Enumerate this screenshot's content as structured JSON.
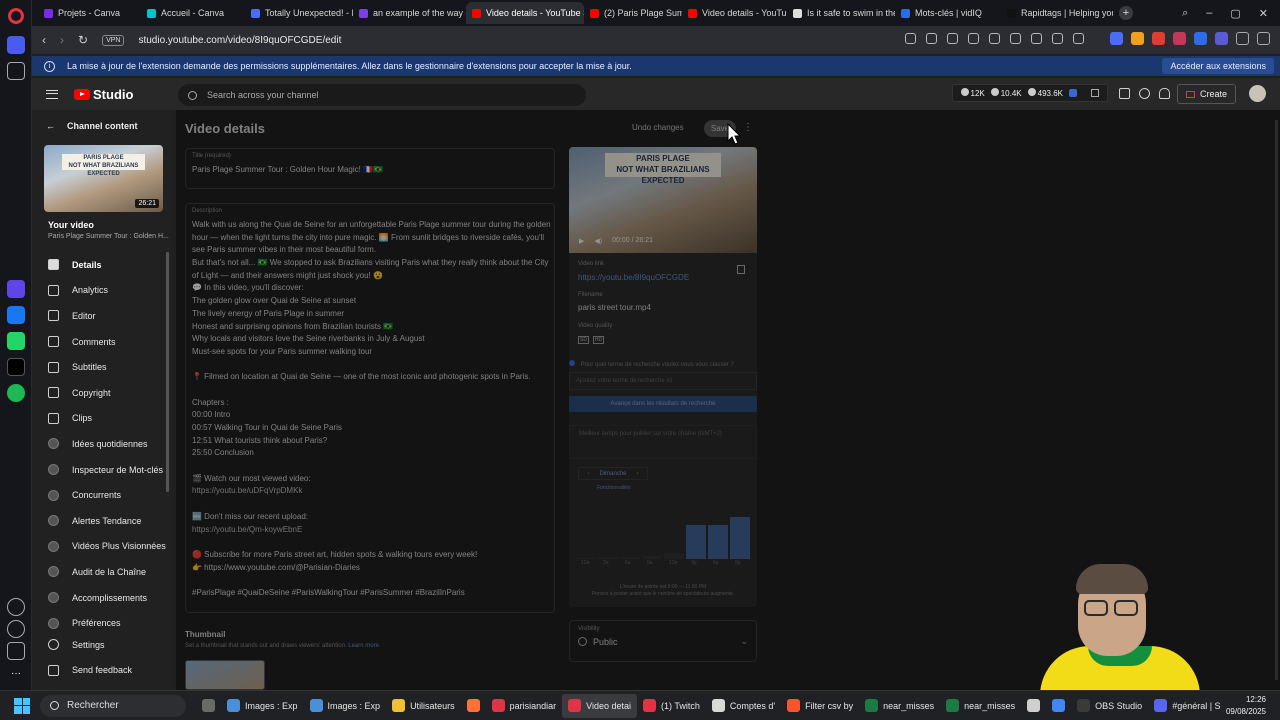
{
  "browser": {
    "tabs": [
      {
        "label": "Projets - Canva",
        "color": "#7d2ae8",
        "active": false
      },
      {
        "label": "Accueil - Canva",
        "color": "#00c4cc",
        "active": false
      },
      {
        "label": "Totally Unexpected! - M",
        "color": "#4a6cf7",
        "active": false
      },
      {
        "label": "an example of the way c",
        "color": "#7b3fe4",
        "active": false
      },
      {
        "label": "Video details - YouTube S",
        "color": "#ff0000",
        "active": true
      },
      {
        "label": "(2) Paris Plage Summer T",
        "color": "#ff0000",
        "active": false
      },
      {
        "label": "Video details - YouTube",
        "color": "#ff0000",
        "active": false
      },
      {
        "label": "Is it safe to swim in the S",
        "color": "#dddddd",
        "active": false
      },
      {
        "label": "Mots-clés | vidIQ",
        "color": "#2e6be6",
        "active": false
      },
      {
        "label": "Rapidtags | Helping you",
        "color": "#111111",
        "active": false
      }
    ],
    "vpn": "VPN",
    "url": "studio.youtube.com/video/8I9quOFCGDE/edit",
    "infobar_text": "La mise à jour de l'extension demande des permissions supplémentaires. Allez dans le gestionnaire d'extensions pour accepter la mise à jour.",
    "infobar_button": "Accéder aux extensions"
  },
  "studio": {
    "logo_text": "Studio",
    "search_placeholder": "Search across your channel",
    "stats": [
      "12K",
      "10.4K",
      "493.6K"
    ],
    "create_label": "Create"
  },
  "sidebar": {
    "channel_content": "Channel content",
    "thumb_banner": "PARIS PLAGE\nNOT WHAT BRAZILIANS EXPECTED",
    "duration": "26:21",
    "your_video": "Your video",
    "video_title": "Paris Plage Summer Tour : Golden H...",
    "items": [
      {
        "label": "Details",
        "active": true,
        "tool": false
      },
      {
        "label": "Analytics",
        "active": false,
        "tool": false
      },
      {
        "label": "Editor",
        "active": false,
        "tool": false
      },
      {
        "label": "Comments",
        "active": false,
        "tool": false
      },
      {
        "label": "Subtitles",
        "active": false,
        "tool": false
      },
      {
        "label": "Copyright",
        "active": false,
        "tool": false
      },
      {
        "label": "Clips",
        "active": false,
        "tool": false
      },
      {
        "label": "Idées quotidiennes",
        "active": false,
        "tool": true
      },
      {
        "label": "Inspecteur de Mot-clés",
        "active": false,
        "tool": true
      },
      {
        "label": "Concurrents",
        "active": false,
        "tool": true
      },
      {
        "label": "Alertes Tendance",
        "active": false,
        "tool": true
      },
      {
        "label": "Vidéos Plus Visionnées",
        "active": false,
        "tool": true
      },
      {
        "label": "Audit de la Chaîne",
        "active": false,
        "tool": true
      },
      {
        "label": "Accomplissements",
        "active": false,
        "tool": true
      },
      {
        "label": "Préférences",
        "active": false,
        "tool": true
      }
    ],
    "settings": "Settings",
    "feedback": "Send feedback"
  },
  "main": {
    "page_title": "Video details",
    "undo": "Undo changes",
    "save": "Save",
    "title_label": "Title (required)",
    "title_value": "Paris Plage Summer Tour : Golden Hour Magic! 🇫🇷🇧🇷",
    "description_label": "Description",
    "description_lines": [
      "Walk with us along the Quai de Seine for an unforgettable Paris Plage summer tour during the golden",
      "hour — when the light turns the city into pure magic. 🌅 From sunlit bridges to riverside cafés, you'll",
      "see Paris summer vibes in their most beautiful form.",
      "But that's not all... 🇧🇷 We stopped to ask Brazilians visiting Paris what they really think about the City",
      "of Light — and their answers might just shock you! 😮",
      "💬 In this video, you'll discover:",
      "The golden glow over Quai de Seine at sunset",
      "The lively energy of Paris Plage in summer",
      "Honest and surprising opinions from Brazilian tourists 🇧🇷",
      "Why locals and visitors love the Seine riverbanks in July & August",
      "Must-see spots for your Paris summer walking tour",
      "",
      "📍 Filmed on location at Quai de Seine — one of the most iconic and photogenic spots in Paris.",
      "",
      "Chapters :",
      "00:00 Intro",
      "00:57 Walking Tour in Quai de Seine Paris",
      "12:51 What tourists think about Paris?",
      "25:50 Conclusion",
      "",
      "🎬 Watch our most viewed video:",
      "https://youtu.be/uDFqVrpDMKk",
      "",
      "🆕 Don't miss our recent upload:",
      "https://youtu.be/Qm-koywEbnE",
      "",
      "🔴 Subscribe for more Paris street art, hidden spots & walking tours every week!",
      "👉 https://www.youtube.com/@Parisian-Diaries",
      "",
      "#ParisPlage #QuaiDeSeine #ParisWalkingTour #ParisSummer #BrazilInParis"
    ],
    "thumbnail_heading": "Thumbnail",
    "thumbnail_sub": "Set a thumbnail that stands out and draws viewers' attention.",
    "learn_more": "Learn more"
  },
  "right": {
    "player_banner": "PARIS PLAGE\nNOT WHAT BRAZILIANS EXPECTED",
    "player_time": "00:00 / 26:21",
    "video_link_label": "Video link",
    "video_link": "https://youtu.be/8I9quOFCGDE",
    "filename_label": "Filename",
    "filename": "paris street tour.mp4",
    "quality_label": "Video quality",
    "quality_badges": [
      "SD",
      "HD"
    ],
    "vidiq_question": "Pour quel terme de recherche voulez-vous vous classer ?",
    "vidiq_placeholder": "Ajoutez votre terme de recherche ici",
    "vidiq_button": "Avançe dans les résultats de recherche",
    "best_time": "Meilleur temps pour publier sur votre chaîne (GMT+2)",
    "day_selected": "Dimanche",
    "chart_legend": "Fonctionnalités",
    "chart_xlabels": [
      "12a",
      "3a",
      "6a",
      "9a",
      "12p",
      "3p",
      "6p",
      "9p"
    ],
    "chart_foot": "L'heure de pointe est 9:00 — 11:00 PM\nPensez à poster avant que le nombre de spectateurs augmente.",
    "visibility_label": "Visibility",
    "visibility_value": "Public"
  },
  "chart_data": {
    "type": "bar",
    "categories": [
      "12a",
      "3a",
      "6a",
      "9a",
      "12p",
      "3p",
      "6p",
      "9p"
    ],
    "values": [
      2,
      3,
      4,
      5,
      10,
      55,
      55,
      68
    ],
    "ylim": [
      0,
      100
    ]
  },
  "taskbar": {
    "search": "Rechercher",
    "items": [
      {
        "label": "",
        "color": "#6a6a6a"
      },
      {
        "label": "Images : Exp",
        "color": "#4a90d9"
      },
      {
        "label": "Images : Exp",
        "color": "#4a90d9"
      },
      {
        "label": "Utilisateurs",
        "color": "#f0c030"
      },
      {
        "label": "",
        "color": "#ff7139"
      },
      {
        "label": "parisiandiar",
        "color": "#e43245"
      },
      {
        "label": "Video detai",
        "color": "#e43245"
      },
      {
        "label": "(1) Twitch",
        "color": "#e43245"
      },
      {
        "label": "Comptes d'",
        "color": "#d9d9d9"
      },
      {
        "label": "Filter csv by",
        "color": "#fb542b"
      },
      {
        "label": "near_misses",
        "color": "#1d7a45"
      },
      {
        "label": "near_misses",
        "color": "#1d7a45"
      },
      {
        "label": "",
        "color": "#cfcfcf"
      },
      {
        "label": "",
        "color": "#4285f4"
      },
      {
        "label": "OBS Studio",
        "color": "#3a3a3a"
      },
      {
        "label": "#général | S",
        "color": "#5865f2"
      }
    ],
    "time": "12:26",
    "date": "09/08/2025"
  },
  "colors": {
    "accent_blue": "#3ea6ff",
    "youtube_red": "#ff0000",
    "infobar": "#1a3770"
  }
}
